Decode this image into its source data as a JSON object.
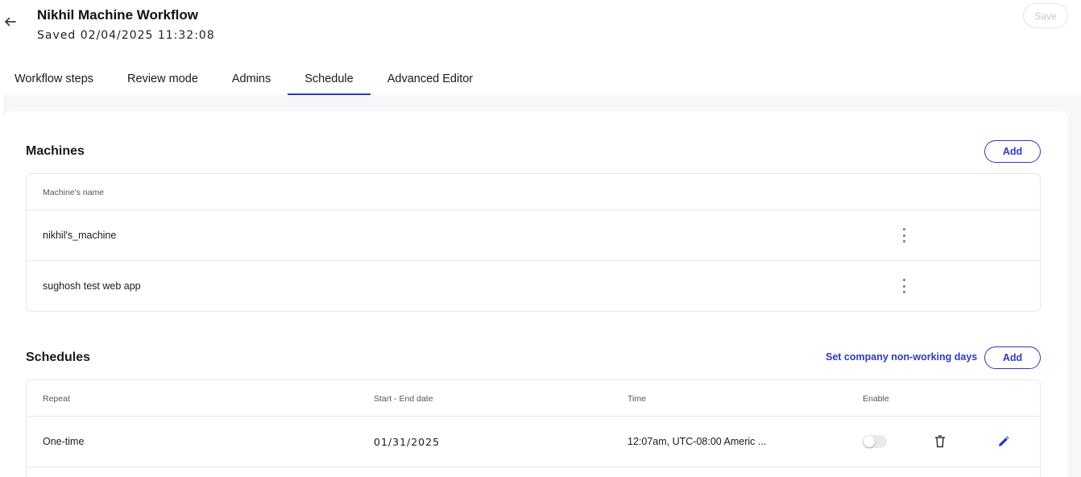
{
  "header": {
    "title": "Nikhil Machine Workflow",
    "saved_text": "Saved 02/04/2025 11:32:08",
    "save_label": "Save"
  },
  "tabs": [
    {
      "label": "Workflow steps"
    },
    {
      "label": "Review mode"
    },
    {
      "label": "Admins"
    },
    {
      "label": "Schedule",
      "active": true
    },
    {
      "label": "Advanced Editor"
    }
  ],
  "machines": {
    "title": "Machines",
    "add_label": "Add",
    "column_header": "Machine's name",
    "rows": [
      {
        "name": "nikhil's_machine"
      },
      {
        "name": "sughosh test web app"
      }
    ]
  },
  "schedules": {
    "title": "Schedules",
    "set_non_working_label": "Set company non-working days",
    "add_label": "Add",
    "columns": {
      "repeat": "Repeat",
      "start_end": "Start - End date",
      "time": "Time",
      "enable": "Enable"
    },
    "rows": [
      {
        "repeat": "One-time",
        "date": "01/31/2025",
        "time": "12:07am, UTC-08:00 Americ ...",
        "enabled": false
      }
    ]
  },
  "colors": {
    "accent": "#2f3bb5",
    "border": "#e6e7ea",
    "background": "#f6f7f9"
  },
  "icons": {
    "back": "arrow-left-icon",
    "row_menu": "kebab-menu-icon",
    "delete": "trash-icon",
    "edit": "pencil-icon"
  }
}
